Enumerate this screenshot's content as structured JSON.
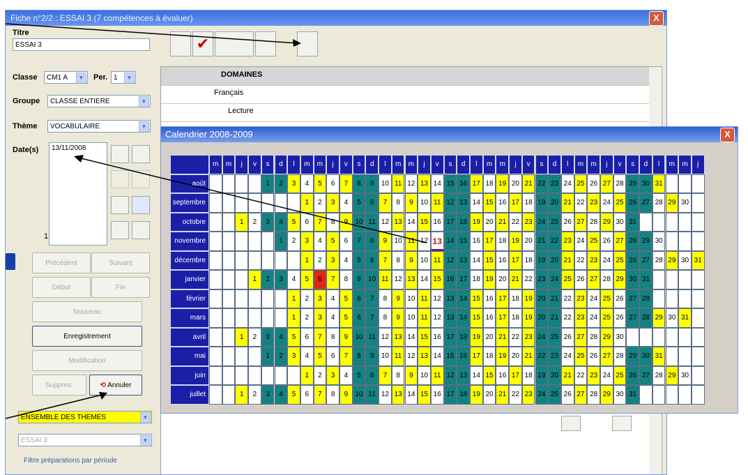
{
  "window": {
    "title": "Fiche n°2/2 : ESSAI  3 (7 compétences à évaluer)",
    "close": "X"
  },
  "form": {
    "titre_label": "Titre",
    "titre_value": "ESSAI 3",
    "classe_label": "Classe",
    "classe_value": "CM1 A",
    "per_label": "Per.",
    "per_value": "1",
    "groupe_label": "Groupe",
    "groupe_value": "CLASSE ENTIERE",
    "theme_label": "Thème",
    "theme_value": "VOCABULAIRE",
    "dates_label": "Date(s)",
    "date_value": "13/11/2008",
    "count": "1"
  },
  "buttons": {
    "precedent": "Précédent",
    "suivant": "Suivant",
    "debut": "Début",
    "fin": "Fin",
    "nouveau": "Nouveau",
    "enregistrement": "Enregistrement",
    "modification": "Modification",
    "suppres": "Suppres.",
    "annuler": "Annuler"
  },
  "filters": {
    "theme_select": "ENSEMBLE DES THEMES",
    "fiche_select": "ESSAI 3",
    "filtre_label": "Filtre préparations par période"
  },
  "tree": {
    "domaines": "DOMAINES",
    "francais": "Français",
    "lecture": "Lecture"
  },
  "calendar": {
    "title": "Calendrier 2008-2009",
    "close": "X",
    "day_headers": [
      "m",
      "m",
      "j",
      "v",
      "s",
      "d",
      "l",
      "m",
      "m",
      "j",
      "v",
      "s",
      "d",
      "l",
      "m",
      "m",
      "j",
      "v",
      "s",
      "d",
      "l",
      "m",
      "m",
      "j",
      "v",
      "s",
      "d",
      "l",
      "m",
      "m",
      "j",
      "v",
      "s",
      "d",
      "l",
      "m",
      "m",
      "j"
    ],
    "months": [
      {
        "name": "août",
        "start": 5,
        "days": 31,
        "marks": {}
      },
      {
        "name": "septembre",
        "start": 8,
        "days": 30,
        "marks": {}
      },
      {
        "name": "octobre",
        "start": 3,
        "days": 31,
        "marks": {}
      },
      {
        "name": "novembre",
        "start": 6,
        "days": 30,
        "marks": {}
      },
      {
        "name": "décembre",
        "start": 8,
        "days": 31,
        "marks": {}
      },
      {
        "name": "janvier",
        "start": 4,
        "days": 31,
        "marks": {}
      },
      {
        "name": "février",
        "start": 7,
        "days": 28,
        "marks": {}
      },
      {
        "name": "mars",
        "start": 7,
        "days": 31,
        "marks": {}
      },
      {
        "name": "avril",
        "start": 3,
        "days": 30,
        "marks": {}
      },
      {
        "name": "mai",
        "start": 5,
        "days": 31,
        "marks": {}
      },
      {
        "name": "juin",
        "start": 8,
        "days": 30,
        "marks": {}
      },
      {
        "name": "juillet",
        "start": 3,
        "days": 31,
        "marks": {}
      }
    ],
    "selected": {
      "month": "novembre",
      "day": 13
    },
    "holiday": {
      "month": "janvier",
      "day": 6
    }
  },
  "colors": {
    "weekend": "#138280",
    "school": "#ffff00",
    "holiday": "#b7cfee",
    "selected": "#c41a10",
    "header": "#1b1fa6"
  }
}
